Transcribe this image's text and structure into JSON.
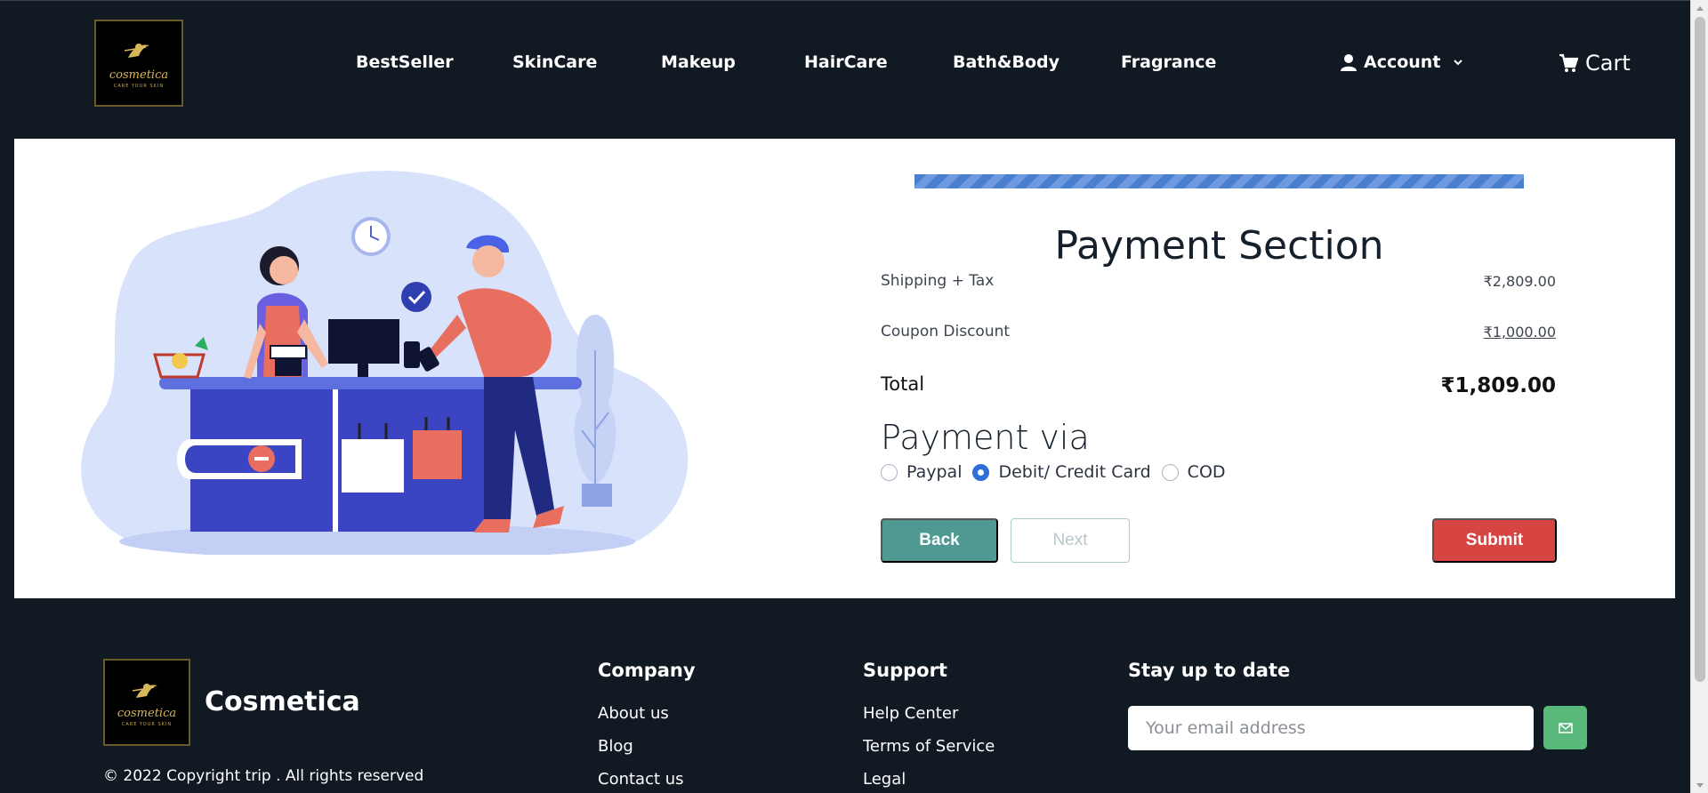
{
  "header": {
    "logo": {
      "word": "cosmetica",
      "tagline": "CARE YOUR SKIN"
    },
    "nav": [
      {
        "label": "BestSeller"
      },
      {
        "label": "SkinCare"
      },
      {
        "label": "Makeup"
      },
      {
        "label": "HairCare"
      },
      {
        "label": "Bath&Body"
      },
      {
        "label": "Fragrance"
      }
    ],
    "account_label": "Account",
    "cart_label": "Cart"
  },
  "payment": {
    "progress_fraction": 1.0,
    "title": "Payment Section",
    "rows": [
      {
        "label": "Shipping + Tax",
        "value": "₹2,809.00"
      },
      {
        "label": "Coupon Discount",
        "value": "₹1,000.00"
      }
    ],
    "total": {
      "label": "Total",
      "value": "₹1,809.00"
    },
    "via_title": "Payment via",
    "options": [
      {
        "label": "Paypal",
        "checked": false
      },
      {
        "label": "Debit/ Credit Card",
        "checked": true
      },
      {
        "label": "COD",
        "checked": false
      }
    ],
    "buttons": {
      "back": "Back",
      "next": "Next",
      "submit": "Submit"
    }
  },
  "footer": {
    "brand": "Cosmetica",
    "copyright": "© 2022 Copyright trip . All rights reserved",
    "company": {
      "title": "Company",
      "links": [
        "About us",
        "Blog",
        "Contact us"
      ]
    },
    "support": {
      "title": "Support",
      "links": [
        "Help Center",
        "Terms of Service",
        "Legal"
      ]
    },
    "newsletter": {
      "title": "Stay up to date",
      "placeholder": "Your email address"
    }
  },
  "colors": {
    "background": "#111923",
    "back_button": "#4e9992",
    "submit_button": "#d64541",
    "email_button": "#58b97b",
    "progress": "#4a7fcf"
  }
}
